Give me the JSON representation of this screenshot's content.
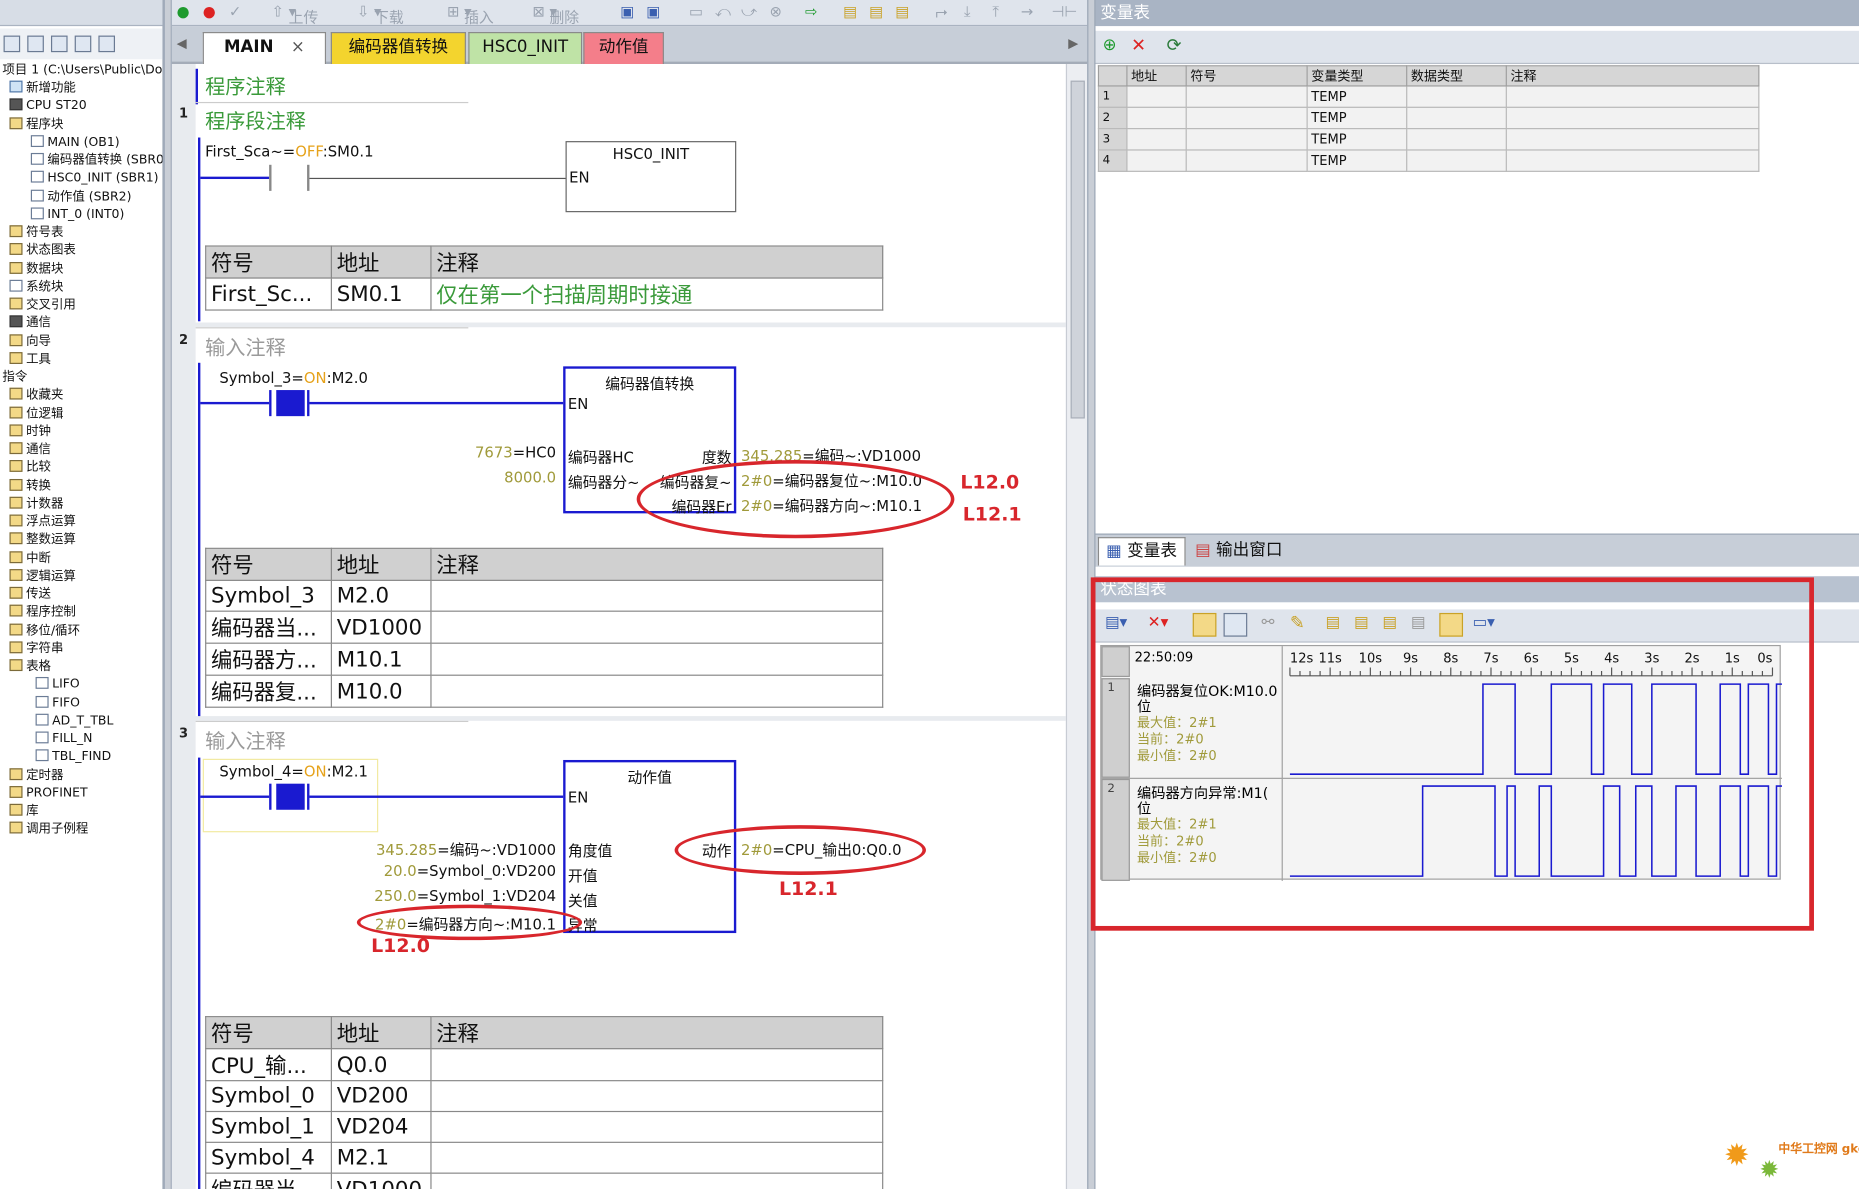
{
  "tree": {
    "project": "项目 1 (C:\\Users\\Public\\Do",
    "items": [
      {
        "label": "新增功能",
        "indent": 6,
        "icon": "gr"
      },
      {
        "label": "CPU ST20",
        "indent": 6,
        "icon": "cpu"
      },
      {
        "label": "程序块",
        "indent": 6,
        "icon": "fo"
      },
      {
        "label": "MAIN (OB1)",
        "indent": 24,
        "icon": "doc"
      },
      {
        "label": "编码器值转换 (SBR0",
        "indent": 24,
        "icon": "doc"
      },
      {
        "label": "HSC0_INIT (SBR1)",
        "indent": 24,
        "icon": "doc"
      },
      {
        "label": "动作值 (SBR2)",
        "indent": 24,
        "icon": "doc"
      },
      {
        "label": "INT_0 (INT0)",
        "indent": 24,
        "icon": "doc"
      },
      {
        "label": "符号表",
        "indent": 6,
        "icon": "fo"
      },
      {
        "label": "状态图表",
        "indent": 6,
        "icon": "fo"
      },
      {
        "label": "数据块",
        "indent": 6,
        "icon": "fo"
      },
      {
        "label": "系统块",
        "indent": 6,
        "icon": "doc"
      },
      {
        "label": "交叉引用",
        "indent": 6,
        "icon": "fo"
      },
      {
        "label": "通信",
        "indent": 6,
        "icon": "cpu"
      },
      {
        "label": "向导",
        "indent": 6,
        "icon": "fo"
      },
      {
        "label": "工具",
        "indent": 6,
        "icon": "fo"
      },
      {
        "label": "指令",
        "indent": 0,
        "icon": "none"
      },
      {
        "label": "收藏夹",
        "indent": 6,
        "icon": "fo"
      },
      {
        "label": "位逻辑",
        "indent": 6,
        "icon": "fo"
      },
      {
        "label": "时钟",
        "indent": 6,
        "icon": "fo"
      },
      {
        "label": "通信",
        "indent": 6,
        "icon": "fo"
      },
      {
        "label": "比较",
        "indent": 6,
        "icon": "fo"
      },
      {
        "label": "转换",
        "indent": 6,
        "icon": "fo"
      },
      {
        "label": "计数器",
        "indent": 6,
        "icon": "fo"
      },
      {
        "label": "浮点运算",
        "indent": 6,
        "icon": "fo"
      },
      {
        "label": "整数运算",
        "indent": 6,
        "icon": "fo"
      },
      {
        "label": "中断",
        "indent": 6,
        "icon": "fo"
      },
      {
        "label": "逻辑运算",
        "indent": 6,
        "icon": "fo"
      },
      {
        "label": "传送",
        "indent": 6,
        "icon": "fo"
      },
      {
        "label": "程序控制",
        "indent": 6,
        "icon": "fo"
      },
      {
        "label": "移位/循环",
        "indent": 6,
        "icon": "fo"
      },
      {
        "label": "字符串",
        "indent": 6,
        "icon": "fo"
      },
      {
        "label": "表格",
        "indent": 6,
        "icon": "fo"
      },
      {
        "label": "LIFO",
        "indent": 28,
        "icon": "doc"
      },
      {
        "label": "FIFO",
        "indent": 28,
        "icon": "doc"
      },
      {
        "label": "AD_T_TBL",
        "indent": 28,
        "icon": "doc"
      },
      {
        "label": "FILL_N",
        "indent": 28,
        "icon": "doc"
      },
      {
        "label": "TBL_FIND",
        "indent": 28,
        "icon": "doc"
      },
      {
        "label": "定时器",
        "indent": 6,
        "icon": "fo"
      },
      {
        "label": "PROFINET",
        "indent": 6,
        "icon": "fo"
      },
      {
        "label": "库",
        "indent": 6,
        "icon": "fo"
      },
      {
        "label": "调用子例程",
        "indent": 6,
        "icon": "fo"
      }
    ]
  },
  "toolbar": {
    "upload": "上传",
    "download": "下载",
    "insert": "插入",
    "delete": "删除"
  },
  "tabs": {
    "main": "MAIN",
    "close": "×",
    "enc": "编码器值转换",
    "hsc": "HSC0_INIT",
    "act": "动作值"
  },
  "editor": {
    "program_comment": "程序注释",
    "n1": {
      "num": "1",
      "comment": "程序段注释",
      "contact_sym": "First_Sca~",
      "contact_eq": "=",
      "contact_state": "OFF",
      "contact_addr": ":SM0.1",
      "block": "HSC0_INIT",
      "en": "EN"
    },
    "n1_table": {
      "h": [
        "符号",
        "地址",
        "注释"
      ],
      "rows": [
        [
          "First_Sc...",
          "SM0.1",
          "仅在第一个扫描周期时接通"
        ]
      ]
    },
    "n2": {
      "num": "2",
      "comment": "输入注释",
      "contact_sym": "Symbol_3",
      "contact_eq": "=",
      "contact_state": "ON",
      "contact_addr": ":M2.0",
      "block": "编码器值转换",
      "en": "EN",
      "in1_val": "7673",
      "in1_sym": "=HC0",
      "in1_pin": "编码器HC",
      "in2_val": "8000.0",
      "in2_sym": "",
      "in2_pin": "编码器分~",
      "out1_pin": "度数",
      "out1_val": "345.285",
      "out1_sym": "=编码~:VD1000",
      "out2_pin": "编码器复~",
      "out2_val": "2#0",
      "out2_sym": "=编码器复位~:M10.0",
      "out3_pin": "编码器Er",
      "out3_val": "2#0",
      "out3_sym": "=编码器方向~:M10.1"
    },
    "n2_table": {
      "h": [
        "符号",
        "地址",
        "注释"
      ],
      "rows": [
        [
          "Symbol_3",
          "M2.0",
          ""
        ],
        [
          "编码器当...",
          "VD1000",
          ""
        ],
        [
          "编码器方...",
          "M10.1",
          ""
        ],
        [
          "编码器复...",
          "M10.0",
          ""
        ]
      ]
    },
    "n3": {
      "num": "3",
      "comment": "输入注释",
      "contact_sym": "Symbol_4",
      "contact_eq": "=",
      "contact_state": "ON",
      "contact_addr": ":M2.1",
      "block": "动作值",
      "en": "EN",
      "in1_val": "345.285",
      "in1_sym": "=编码~:VD1000",
      "in1_pin": "角度值",
      "in2_val": "20.0",
      "in2_sym": "=Symbol_0:VD200",
      "in2_pin": "开值",
      "in3_val": "250.0",
      "in3_sym": "=Symbol_1:VD204",
      "in3_pin": "关值",
      "in4_val": "2#0",
      "in4_sym": "=编码器方向~:M10.1",
      "in4_pin": "异常",
      "out1_pin": "动作",
      "out1_val": "2#0",
      "out1_sym": "=CPU_输出0:Q0.0"
    },
    "n3_table": {
      "h": [
        "符号",
        "地址",
        "注释"
      ],
      "rows": [
        [
          "CPU_输...",
          "Q0.0",
          ""
        ],
        [
          "Symbol_0",
          "VD200",
          ""
        ],
        [
          "Symbol_1",
          "VD204",
          ""
        ],
        [
          "Symbol_4",
          "M2.1",
          ""
        ],
        [
          "编码器当...",
          "VD1000",
          ""
        ]
      ]
    },
    "annotations": {
      "l120a": "L12.0",
      "l121a": "L12.1",
      "l121b": "L12.1",
      "l120b": "L12.0"
    }
  },
  "vartable": {
    "title": "变量表",
    "headers": [
      "",
      "地址",
      "符号",
      "变量类型",
      "数据类型",
      "注释"
    ],
    "rows": [
      [
        "1",
        "",
        "",
        "TEMP",
        "",
        ""
      ],
      [
        "2",
        "",
        "",
        "TEMP",
        "",
        ""
      ],
      [
        "3",
        "",
        "",
        "TEMP",
        "",
        ""
      ],
      [
        "4",
        "",
        "",
        "TEMP",
        "",
        ""
      ]
    ]
  },
  "bottom_tabs": {
    "vartable": "变量表",
    "output": "输出窗口"
  },
  "status_chart": {
    "title": "状态图表",
    "time": "22:50:09",
    "time_ticks": [
      "12s",
      "11s",
      "10s",
      "9s",
      "8s",
      "7s",
      "6s",
      "5s",
      "4s",
      "3s",
      "2s",
      "1s",
      "0s"
    ],
    "rows": [
      {
        "num": "1",
        "name": "编码器复位OK:M10.0",
        "suffix": "位",
        "max_label": "最大值：",
        "max": "2#1",
        "cur_label": "当前：",
        "cur": "2#0",
        "min_label": "最小值：",
        "min": "2#0",
        "signal": [
          [
            0,
            0
          ],
          [
            4.8,
            1
          ],
          [
            5.6,
            0
          ],
          [
            6.5,
            1
          ],
          [
            7.5,
            0
          ],
          [
            7.8,
            1
          ],
          [
            8.5,
            0
          ],
          [
            9.0,
            1
          ],
          [
            10.1,
            0
          ],
          [
            10.7,
            1
          ],
          [
            11.2,
            0
          ],
          [
            11.4,
            1
          ],
          [
            11.9,
            0
          ],
          [
            12.1,
            1
          ],
          [
            12.6,
            0
          ]
        ]
      },
      {
        "num": "2",
        "name": "编码器方向异常:M1(",
        "suffix": "位",
        "max_label": "最大值：",
        "max": "2#1",
        "cur_label": "当前：",
        "cur": "2#0",
        "min_label": "最小值：",
        "min": "2#0",
        "signal": [
          [
            0,
            0
          ],
          [
            3.3,
            1
          ],
          [
            5.1,
            0
          ],
          [
            5.4,
            1
          ],
          [
            5.6,
            0
          ],
          [
            6.2,
            1
          ],
          [
            6.5,
            0
          ],
          [
            7.8,
            1
          ],
          [
            8.2,
            0
          ],
          [
            8.6,
            1
          ],
          [
            9.0,
            0
          ],
          [
            9.6,
            1
          ],
          [
            10.1,
            0
          ],
          [
            10.7,
            1
          ],
          [
            11.2,
            0
          ],
          [
            11.4,
            1
          ],
          [
            11.9,
            0
          ],
          [
            12.1,
            1
          ],
          [
            12.6,
            0
          ]
        ]
      }
    ]
  },
  "watermark": "中华工控网 gkong.com"
}
